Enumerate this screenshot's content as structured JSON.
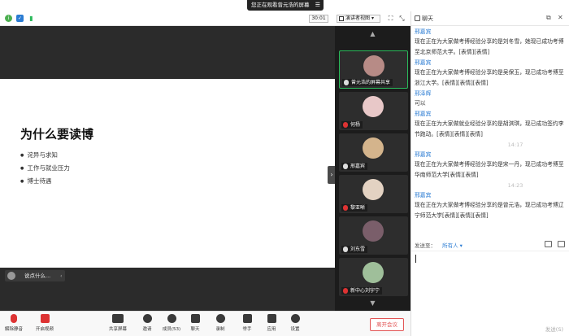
{
  "banner": {
    "text": "您正在观看曾元浩的屏幕",
    "menu_icon": "menu-icon"
  },
  "topbar": {
    "timer": "30:01",
    "view_mode": "演讲者视图",
    "icons": [
      "info-icon",
      "shield-icon",
      "signal-icon",
      "fullscreen-icon",
      "exit-fullscreen-icon",
      "panel-icon"
    ]
  },
  "slide": {
    "title": "为什么要读博",
    "bullets": [
      "诧异与求知",
      "工作与就业压力",
      "博士待遇"
    ]
  },
  "comment": {
    "placeholder": "说点什么..."
  },
  "participants": [
    {
      "name": "曾元浩的屏幕共享",
      "muted": false,
      "active": true,
      "color": "#b78b86"
    },
    {
      "name": "何杨",
      "muted": true,
      "active": false,
      "color": "#e8c8c8"
    },
    {
      "name": "邢嘉宾",
      "muted": false,
      "active": false,
      "color": "#d4b48c"
    },
    {
      "name": "黎亚晰",
      "muted": true,
      "active": false,
      "color": "#e3d2c2"
    },
    {
      "name": "刘东雪",
      "muted": false,
      "active": false,
      "color": "#7a5e6a"
    },
    {
      "name": "新中心刘宇宁",
      "muted": true,
      "active": false,
      "color": "#9fbf9a"
    }
  ],
  "controls": [
    {
      "label": "解除静音",
      "icon": "mic-muted-icon"
    },
    {
      "label": "开启视频",
      "icon": "video-off-icon"
    },
    {
      "label": "共享屏幕",
      "icon": "share-screen-icon"
    },
    {
      "label": "邀请",
      "icon": "invite-icon"
    },
    {
      "label": "成员(53)",
      "icon": "members-icon"
    },
    {
      "label": "聊天",
      "icon": "chat-icon"
    },
    {
      "label": "录制",
      "icon": "record-icon"
    },
    {
      "label": "举手",
      "icon": "hand-icon"
    },
    {
      "label": "应用",
      "icon": "apps-icon"
    },
    {
      "label": "设置",
      "icon": "settings-icon"
    }
  ],
  "leave_label": "离开会议",
  "chat": {
    "title": "聊天",
    "messages": [
      {
        "sender": "邢嘉宾",
        "text": "现在正在为大家做考博经验分享的是刘冬雪，她现已成功考博至北京师范大学。[表情][表情]",
        "time": ""
      },
      {
        "sender": "邢嘉宾",
        "text": "现在正在为大家做考博经验分享的是吴保玉，现已成功考博至浙江大学。[表情][表情][表情]",
        "time": ""
      },
      {
        "sender": "邢泽辉",
        "text": "可以",
        "time": ""
      },
      {
        "sender": "邢嘉宾",
        "text": "现在正在为大家做就业经验分享的是胡淇琪，现已成功签约李节跑动。[表情][表情][表情]",
        "time": "14:17"
      },
      {
        "sender": "邢嘉宾",
        "text": "现在正在为大家做考博经验分享的是宋一丹，现已成功考博至华南师范大学[表情][表情]",
        "time": "14:23"
      },
      {
        "sender": "邢嘉宾",
        "text": "现在正在为大家做考博经验分享的是曾元浩，现已成功考博辽宁师范大学[表情][表情][表情]",
        "time": ""
      }
    ],
    "send_to_label": "发送至：",
    "send_to_value": "所有人 ▾",
    "send_label": "发送(S)"
  }
}
